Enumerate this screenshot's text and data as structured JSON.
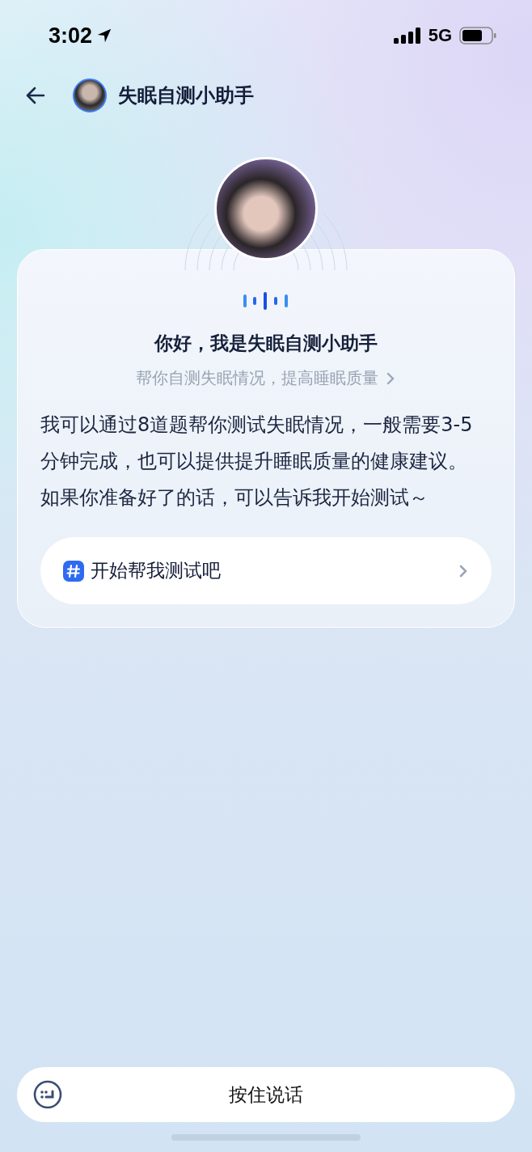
{
  "status_bar": {
    "time": "3:02",
    "network": "5G"
  },
  "nav": {
    "title": "失眠自测小助手"
  },
  "intro_card": {
    "title": "你好，我是失眠自测小助手",
    "subtitle": "帮你自测失眠情况，提高睡眠质量",
    "message": "我可以通过8道题帮你测试失眠情况，一般需要3-5分钟完成，也可以提供提升睡眠质量的健康建议。如果你准备好了的话，可以告诉我开始测试～",
    "suggestions": [
      {
        "label": "开始帮我测试吧"
      }
    ]
  },
  "input_bar": {
    "label": "按住说话"
  }
}
